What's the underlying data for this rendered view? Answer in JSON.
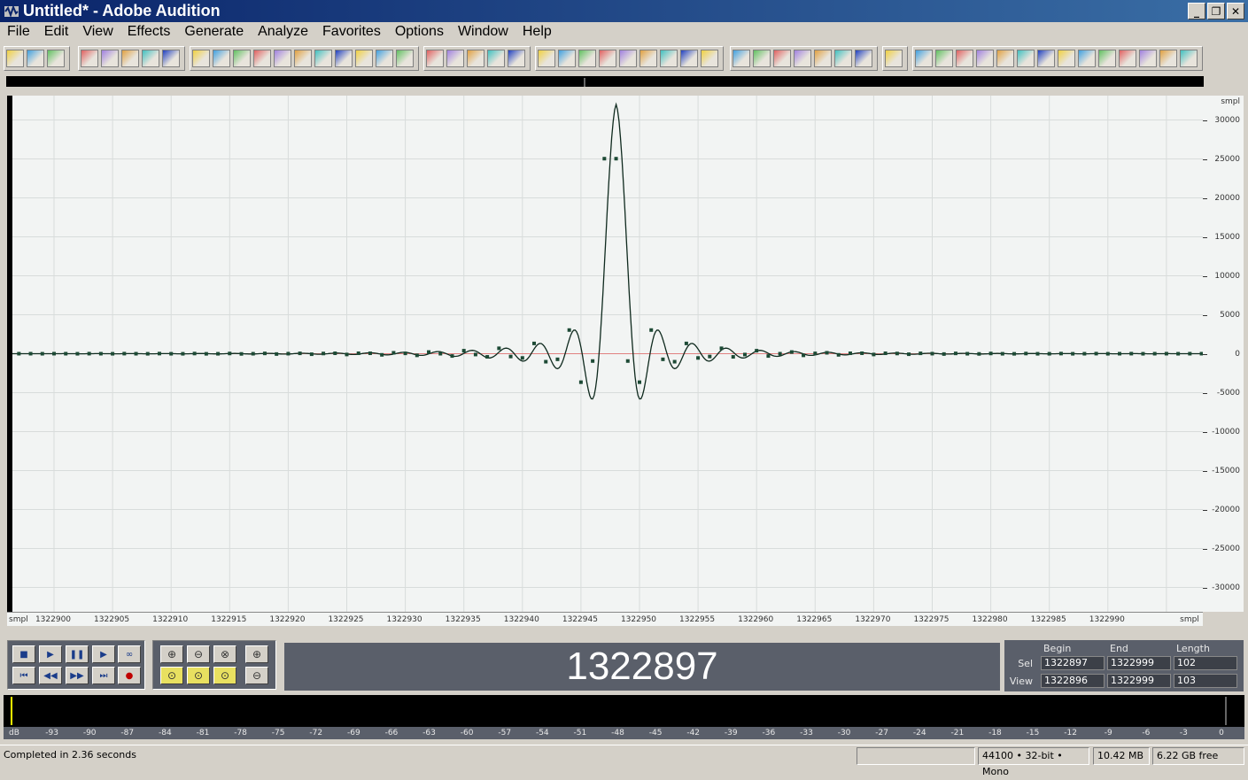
{
  "window": {
    "title": "Untitled* - Adobe Audition"
  },
  "window_controls": {
    "minimize": "_",
    "maximize": "❐",
    "close": "✕"
  },
  "menu": [
    "File",
    "Edit",
    "View",
    "Effects",
    "Generate",
    "Analyze",
    "Favorites",
    "Options",
    "Window",
    "Help"
  ],
  "waveform": {
    "units_label": "smpl",
    "amplitude_labels": [
      "30000",
      "25000",
      "20000",
      "15000",
      "10000",
      "5000",
      "0",
      "-5000",
      "-10000",
      "-15000",
      "-20000",
      "-25000",
      "-30000"
    ],
    "time_unit_label": "smpl",
    "time_labels": [
      "1322900",
      "1322905",
      "1322910",
      "1322915",
      "1322920",
      "1322925",
      "1322930",
      "1322935",
      "1322940",
      "1322945",
      "1322950",
      "1322955",
      "1322960",
      "1322965",
      "1322970",
      "1322975",
      "1322980",
      "1322985",
      "1322990"
    ],
    "colors": {
      "background": "#f2f4f3",
      "grid": "#d8dcdb",
      "line": "#0f2a1e",
      "sample": "#1d4a35",
      "center": "#e08080"
    }
  },
  "transport": {
    "stop": "■",
    "play": "▶",
    "pause": "❚❚",
    "play_to_end": "▶",
    "loop": "∞",
    "go_begin": "⏮",
    "rewind": "◀◀",
    "forward": "▶▶",
    "go_end": "⏭",
    "record": "●"
  },
  "zoom": {
    "zoom_in_h": "⊕",
    "zoom_out_h": "⊖",
    "zoom_full": "⊗",
    "zoom_in_v": "⊕",
    "zoom_sel": "⊙",
    "zoom_left": "⊙",
    "zoom_right": "⊙",
    "zoom_out_v": "⊖"
  },
  "time_display": "1322897",
  "selection": {
    "headers": {
      "begin": "Begin",
      "end": "End",
      "length": "Length"
    },
    "sel": {
      "label": "Sel",
      "begin": "1322897",
      "end": "1322999",
      "length": "102"
    },
    "view": {
      "label": "View",
      "begin": "1322896",
      "end": "1322999",
      "length": "103"
    }
  },
  "level_meter": {
    "labels": [
      "dB",
      "-93",
      "-90",
      "-87",
      "-84",
      "-81",
      "-78",
      "-75",
      "-72",
      "-69",
      "-66",
      "-63",
      "-60",
      "-57",
      "-54",
      "-51",
      "-48",
      "-45",
      "-42",
      "-39",
      "-36",
      "-33",
      "-30",
      "-27",
      "-24",
      "-21",
      "-18",
      "-15",
      "-12",
      "-9",
      "-6",
      "-3",
      "0"
    ]
  },
  "status": {
    "message": "Completed in 2.36 seconds",
    "format": "44100 • 32-bit • Mono",
    "size": "10.42 MB",
    "free": "6.22 GB free"
  }
}
